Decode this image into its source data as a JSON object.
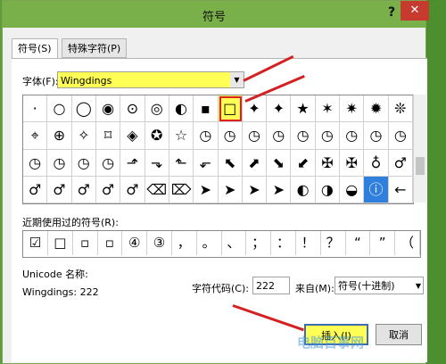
{
  "dialog": {
    "title": "符号",
    "help": "?",
    "close": "✕"
  },
  "tabs": [
    "符号(S)",
    "特殊字符(P)"
  ],
  "font_label": "字体(F):",
  "font_value": "Wingdings",
  "grid_rows": [
    [
      "·",
      "○",
      "◯",
      "◉",
      "⊙",
      "◎",
      "◐",
      "▪",
      "□",
      "✦",
      "✦",
      "★",
      "✶",
      "✷",
      "✹",
      "❊"
    ],
    [
      "⌖",
      "⊕",
      "✧",
      "⌑",
      "◈",
      "✪",
      "☆",
      "◷",
      "◷",
      "◷",
      "◷",
      "◷",
      "◷",
      "◷",
      "◷",
      "◷"
    ],
    [
      "◷",
      "◷",
      "◷",
      "◷",
      "⬏",
      "⬎",
      "⬑",
      "⬐",
      "⬉",
      "⬈",
      "⬊",
      "⬋",
      "✠",
      "✠",
      "♁",
      "♂"
    ],
    [
      "♂",
      "♂",
      "♂",
      "♂",
      "♂",
      "⌫",
      "⌦",
      "➤",
      "➤",
      "➤",
      "➤",
      "◐",
      "◑",
      "◒",
      "ⓘ",
      "←"
    ]
  ],
  "recent_label": "近期使用过的符号(R):",
  "recent": [
    "☑",
    "□",
    "▫",
    "▫",
    "④",
    "③",
    "，",
    "。",
    "、",
    "；",
    "：",
    "！",
    "？",
    "“",
    "”",
    "（"
  ],
  "unicode_label": "Unicode 名称:",
  "unicode_value": "Wingdings: 222",
  "charcode_label": "字符代码(C):",
  "charcode_value": "222",
  "from_label": "来自(M):",
  "from_value": "符号(十进制)",
  "insert_label": "插入(I)",
  "cancel_label": "取消",
  "watermark": "电脑百事网"
}
